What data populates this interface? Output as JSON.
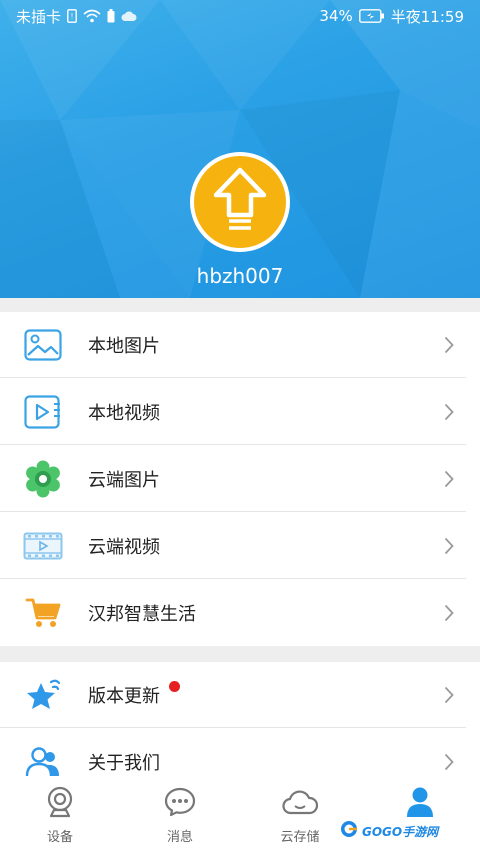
{
  "status_bar": {
    "sim_text": "未插卡",
    "battery": "34%",
    "time": "半夜11:59"
  },
  "profile": {
    "username": "hbzh007",
    "avatar_icon": "upload-arrow-icon"
  },
  "menu": {
    "items": [
      {
        "label": "本地图片",
        "icon": "picture-icon"
      },
      {
        "label": "本地视频",
        "icon": "video-file-icon"
      },
      {
        "label": "云端图片",
        "icon": "flower-icon"
      },
      {
        "label": "云端视频",
        "icon": "film-icon"
      },
      {
        "label": "汉邦智慧生活",
        "icon": "cart-icon"
      },
      {
        "label": "版本更新",
        "icon": "star-icon"
      },
      {
        "label": "关于我们",
        "icon": "people-icon"
      }
    ]
  },
  "tabs": [
    {
      "label": "设备",
      "icon": "camera-icon",
      "active": false
    },
    {
      "label": "消息",
      "icon": "chat-icon",
      "active": false
    },
    {
      "label": "云存储",
      "icon": "cloud-icon",
      "active": false
    },
    {
      "label": "",
      "icon": "person-icon",
      "active": true
    }
  ],
  "watermark": "GOGO手游网",
  "colors": {
    "header_blue": "#2aa0e6",
    "avatar_yellow": "#f6b20e",
    "active_tab": "#2196e8",
    "badge_red": "#e52020"
  }
}
